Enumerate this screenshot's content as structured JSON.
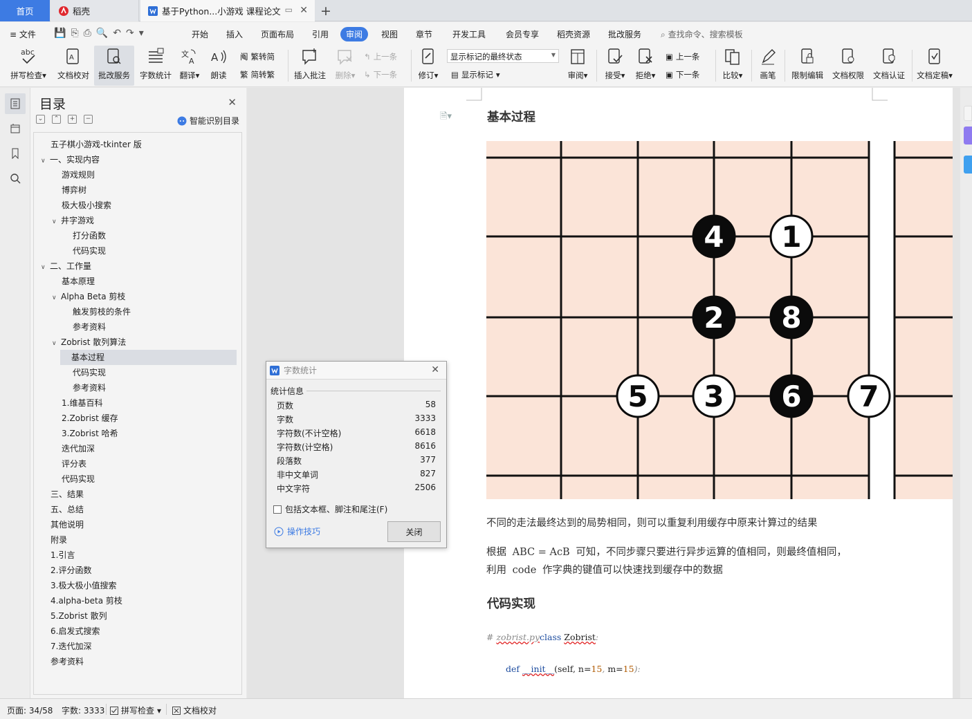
{
  "tabs": {
    "home": "首页",
    "daoke": "稻壳",
    "document": "基于Python...小游戏 课程论文"
  },
  "menu": {
    "file": "文件",
    "items": [
      "开始",
      "插入",
      "页面布局",
      "引用",
      "审阅",
      "视图",
      "章节",
      "开发工具",
      "会员专享",
      "稻壳资源",
      "批改服务"
    ],
    "active": "审阅",
    "search_placeholder": "查找命令、搜索模板"
  },
  "ribbon": {
    "spell_check": "拼写检查",
    "doc_proof": "文档校对",
    "correction_service": "批改服务",
    "word_count": "字数统计",
    "translate": "翻译",
    "read_aloud": "朗读",
    "trad_to_simp": "繁转简",
    "simp_to_trad": "简转繁",
    "insert_comment": "插入批注",
    "delete": "删除",
    "prev_comment": "上一条",
    "next_comment": "下一条",
    "revise": "修订",
    "markup_state": "显示标记的最终状态",
    "show_markup": "显示标记",
    "review": "审阅",
    "accept": "接受",
    "reject": "拒绝",
    "prev_change": "上一条",
    "next_change": "下一条",
    "compare": "比较",
    "pen": "画笔",
    "restrict_edit": "限制编辑",
    "doc_permission": "文档权限",
    "doc_certify": "文档认证",
    "doc_finalize": "文档定稿"
  },
  "toc": {
    "title": "目录",
    "smart_recognize": "智能识别目录",
    "items": [
      {
        "text": "五子棋小游戏-tkinter 版",
        "level": 0,
        "caret": ""
      },
      {
        "text": "一、实现内容",
        "level": 0,
        "caret": "v"
      },
      {
        "text": "游戏规则",
        "level": 1,
        "caret": ""
      },
      {
        "text": "博弈树",
        "level": 1,
        "caret": ""
      },
      {
        "text": "极大极小搜索",
        "level": 1,
        "caret": ""
      },
      {
        "text": "井字游戏",
        "level": 1,
        "caret": "v"
      },
      {
        "text": "打分函数",
        "level": 2,
        "caret": ""
      },
      {
        "text": "代码实现",
        "level": 2,
        "caret": ""
      },
      {
        "text": "二、工作量",
        "level": 0,
        "caret": "v"
      },
      {
        "text": "基本原理",
        "level": 1,
        "caret": ""
      },
      {
        "text": "Alpha Beta 剪枝",
        "level": 1,
        "caret": "v"
      },
      {
        "text": "触发剪枝的条件",
        "level": 2,
        "caret": ""
      },
      {
        "text": "参考资料",
        "level": 2,
        "caret": ""
      },
      {
        "text": "Zobrist 散列算法",
        "level": 1,
        "caret": "v"
      },
      {
        "text": "基本过程",
        "level": 2,
        "caret": "",
        "selected": true
      },
      {
        "text": "代码实现",
        "level": 2,
        "caret": ""
      },
      {
        "text": "参考资料",
        "level": 2,
        "caret": ""
      },
      {
        "text": "1.维基百科",
        "level": 1,
        "caret": ""
      },
      {
        "text": "2.Zobrist 缓存",
        "level": 1,
        "caret": ""
      },
      {
        "text": "3.Zobrist 哈希",
        "level": 1,
        "caret": ""
      },
      {
        "text": "迭代加深",
        "level": 1,
        "caret": ""
      },
      {
        "text": "评分表",
        "level": 1,
        "caret": ""
      },
      {
        "text": "代码实现",
        "level": 1,
        "caret": ""
      },
      {
        "text": "三、结果",
        "level": 0,
        "caret": ""
      },
      {
        "text": "五、总结",
        "level": 0,
        "caret": ""
      },
      {
        "text": "其他说明",
        "level": 0,
        "caret": ""
      },
      {
        "text": "附录",
        "level": 0,
        "caret": ""
      },
      {
        "text": "1.引言",
        "level": 0,
        "caret": ""
      },
      {
        "text": "2.评分函数",
        "level": 0,
        "caret": ""
      },
      {
        "text": "3.极大极小值搜索",
        "level": 0,
        "caret": ""
      },
      {
        "text": "4.alpha-beta 剪枝",
        "level": 0,
        "caret": ""
      },
      {
        "text": "5.Zobrist 散列",
        "level": 0,
        "caret": ""
      },
      {
        "text": "6.启发式搜索",
        "level": 0,
        "caret": ""
      },
      {
        "text": "7.迭代加深",
        "level": 0,
        "caret": ""
      },
      {
        "text": "参考资料",
        "level": 0,
        "caret": ""
      }
    ]
  },
  "document": {
    "heading_basic": "基本过程",
    "board": {
      "stones": [
        {
          "label": "4",
          "color": "black",
          "col": 2,
          "row": 1
        },
        {
          "label": "1",
          "color": "white",
          "col": 3,
          "row": 1
        },
        {
          "label": "2",
          "color": "black",
          "col": 2,
          "row": 2
        },
        {
          "label": "8",
          "color": "black",
          "col": 3,
          "row": 2
        },
        {
          "label": "5",
          "color": "white",
          "col": 1,
          "row": 3
        },
        {
          "label": "3",
          "color": "white",
          "col": 2,
          "row": 3
        },
        {
          "label": "6",
          "color": "black",
          "col": 3,
          "row": 3
        },
        {
          "label": "7",
          "color": "white",
          "col": 4,
          "row": 3
        }
      ],
      "board_color": "#fbe4d8"
    },
    "para1": "不同的走法最终达到的局势相同，则可以重复利用缓存中原来计算过的结果",
    "para2_prefix": "根据",
    "para2_formula": "ABC = AcB",
    "para2_suffix": "可知，不同步骤只要进行异步运算的值相同，则最终值相同，",
    "para3_prefix": "利用",
    "para3_code": "code",
    "para3_suffix": "作字典的键值可以快速找到缓存中的数据",
    "heading_code": "代码实现",
    "code1": {
      "hash": "#",
      "comment": "zobrist.py",
      "kw": "class",
      "name": "Zobrist",
      "colon": ":"
    },
    "code2": {
      "kw": "def",
      "fn": "__init__",
      "open": "(self,",
      "p1": "n=",
      "v1": "15",
      "sep": ",",
      "p2": "m=",
      "v2": "15",
      "close": "):"
    }
  },
  "word_count_dialog": {
    "title": "字数统计",
    "section": "统计信息",
    "rows": [
      {
        "label": "页数",
        "value": "58"
      },
      {
        "label": "字数",
        "value": "3333"
      },
      {
        "label": "字符数(不计空格)",
        "value": "6618"
      },
      {
        "label": "字符数(计空格)",
        "value": "8616"
      },
      {
        "label": "段落数",
        "value": "377"
      },
      {
        "label": "非中文单词",
        "value": "827"
      },
      {
        "label": "中文字符",
        "value": "2506"
      }
    ],
    "include_label": "包括文本框、脚注和尾注(F)",
    "include_checked": false,
    "tips": "操作技巧",
    "close": "关闭"
  },
  "status": {
    "page": "页面: 34/58",
    "words": "字数: 3333",
    "spell": "拼写检查",
    "proof": "文档校对"
  },
  "colors": {
    "accent": "#3d7be3",
    "board": "#fbe4d8"
  }
}
